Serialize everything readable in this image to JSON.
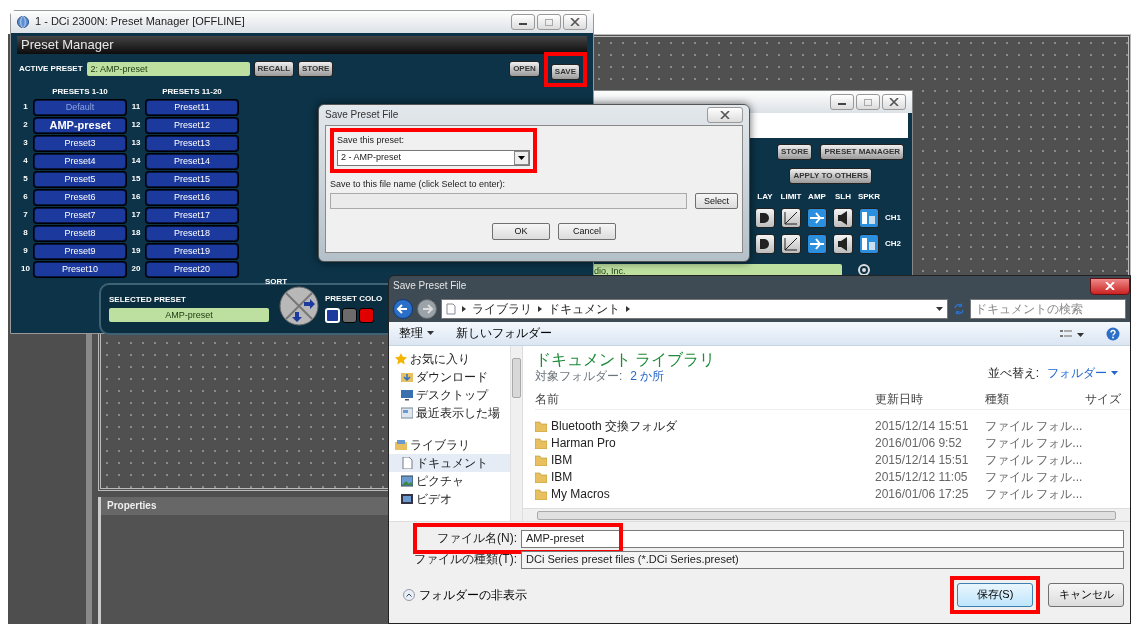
{
  "app": {
    "properties_title": "Properties"
  },
  "preset_manager": {
    "title": "1 - DCi 2300N: Preset Manager [OFFLINE]",
    "heading": "Preset Manager",
    "active_label": "ACTIVE PRESET",
    "active_value": "2: AMP-preset",
    "actions": [
      {
        "label": "RECALL",
        "highlighted": false
      },
      {
        "label": "STORE",
        "highlighted": false
      }
    ],
    "file_actions": [
      {
        "label": "OPEN",
        "highlighted": false
      },
      {
        "label": "SAVE",
        "highlighted": true
      }
    ],
    "columns": [
      {
        "heading": "PRESETS 1-10",
        "presets": [
          {
            "number": "1",
            "name": "Default",
            "selected": false,
            "dimmed": true
          },
          {
            "number": "2",
            "name": "AMP-preset",
            "selected": true,
            "dimmed": false
          },
          {
            "number": "3",
            "name": "Preset3",
            "selected": false,
            "dimmed": false
          },
          {
            "number": "4",
            "name": "Preset4",
            "selected": false,
            "dimmed": false
          },
          {
            "number": "5",
            "name": "Preset5",
            "selected": false,
            "dimmed": false
          },
          {
            "number": "6",
            "name": "Preset6",
            "selected": false,
            "dimmed": false
          },
          {
            "number": "7",
            "name": "Preset7",
            "selected": false,
            "dimmed": false
          },
          {
            "number": "8",
            "name": "Preset8",
            "selected": false,
            "dimmed": false
          },
          {
            "number": "9",
            "name": "Preset9",
            "selected": false,
            "dimmed": false
          },
          {
            "number": "10",
            "name": "Preset10",
            "selected": false,
            "dimmed": false
          }
        ]
      },
      {
        "heading": "PRESETS 11-20",
        "presets": [
          {
            "number": "11",
            "name": "Preset11",
            "selected": false,
            "dimmed": false
          },
          {
            "number": "12",
            "name": "Preset12",
            "selected": false,
            "dimmed": false
          },
          {
            "number": "13",
            "name": "Preset13",
            "selected": false,
            "dimmed": false
          },
          {
            "number": "14",
            "name": "Preset14",
            "selected": false,
            "dimmed": false
          },
          {
            "number": "15",
            "name": "Preset15",
            "selected": false,
            "dimmed": false
          },
          {
            "number": "16",
            "name": "Preset16",
            "selected": false,
            "dimmed": false
          },
          {
            "number": "17",
            "name": "Preset17",
            "selected": false,
            "dimmed": false
          },
          {
            "number": "18",
            "name": "Preset18",
            "selected": false,
            "dimmed": false
          },
          {
            "number": "19",
            "name": "Preset19",
            "selected": false,
            "dimmed": false
          },
          {
            "number": "20",
            "name": "Preset20",
            "selected": false,
            "dimmed": false
          }
        ]
      }
    ],
    "selected_label": "SELECTED PRESET",
    "selected_value": "AMP-preset",
    "sort_label": "SORT",
    "color_label": "PRESET COLO",
    "colors": [
      {
        "color": "#1d3b9e",
        "selected": true
      },
      {
        "color": "#6b6b6b",
        "selected": false
      },
      {
        "color": "#e00000",
        "selected": false
      }
    ]
  },
  "device_window": {
    "actions": [
      "STORE",
      "PRESET MANAGER",
      "APPLY TO OTHERS"
    ],
    "block_labels": [
      "LAY",
      "LIMIT",
      "AMP",
      "SLH",
      "SPKR"
    ],
    "channels": [
      {
        "label": "CH1",
        "blocks": [
          {
            "kind": "delay",
            "on": false
          },
          {
            "kind": "limiter",
            "on": false
          },
          {
            "kind": "amp",
            "on": true
          },
          {
            "kind": "speaker",
            "on": false
          },
          {
            "kind": "eq",
            "on": true
          }
        ]
      },
      {
        "label": "CH2",
        "blocks": [
          {
            "kind": "delay",
            "on": false
          },
          {
            "kind": "limiter",
            "on": false
          },
          {
            "kind": "amp",
            "on": true
          },
          {
            "kind": "speaker",
            "on": false
          },
          {
            "kind": "eq",
            "on": true
          }
        ]
      }
    ],
    "info": "dio, Inc."
  },
  "preset_dialog": {
    "title": "Save Preset File",
    "preset_label": "Save this preset:",
    "preset_value": "2 - AMP-preset",
    "highlighted": true,
    "file_label": "Save to this file name (click Select to enter):",
    "select_button": "Select",
    "buttons": [
      "OK",
      "Cancel"
    ]
  },
  "file_dialog": {
    "title": "Save Preset File",
    "breadcrumb": [
      "ライブラリ",
      "ドキュメント"
    ],
    "search_placeholder": "ドキュメントの検索",
    "toolbar": [
      {
        "label": "整理",
        "dropdown": true
      },
      {
        "label": "新しいフォルダー",
        "dropdown": false
      }
    ],
    "nav": [
      {
        "label": "お気に入り",
        "kind": "favorites",
        "selected": false,
        "children": [
          {
            "label": "ダウンロード",
            "kind": "download",
            "selected": false
          },
          {
            "label": "デスクトップ",
            "kind": "desktop",
            "selected": false
          },
          {
            "label": "最近表示した場",
            "kind": "recent",
            "selected": false
          }
        ]
      },
      {
        "label": "ライブラリ",
        "kind": "library",
        "selected": false,
        "children": [
          {
            "label": "ドキュメント",
            "kind": "document",
            "selected": true
          },
          {
            "label": "ピクチャ",
            "kind": "picture",
            "selected": false
          },
          {
            "label": "ビデオ",
            "kind": "video",
            "selected": false
          }
        ]
      }
    ],
    "library_title": "ドキュメント ライブラリ",
    "target_label": "対象フォルダー:",
    "target_link": "2 か所",
    "sort_label": "並べ替え:",
    "sort_value": "フォルダー",
    "columns": [
      "名前",
      "更新日時",
      "種類",
      "サイズ"
    ],
    "rows": [
      {
        "name": "Bluetooth 交換フォルダ",
        "modified": "2015/12/14 15:51",
        "type": "ファイル フォル..."
      },
      {
        "name": "Harman Pro",
        "modified": "2016/01/06 9:52",
        "type": "ファイル フォル..."
      },
      {
        "name": "IBM",
        "modified": "2015/12/14 15:51",
        "type": "ファイル フォル..."
      },
      {
        "name": "IBM",
        "modified": "2015/12/12 11:05",
        "type": "ファイル フォル..."
      },
      {
        "name": "My Macros",
        "modified": "2016/01/06 17:25",
        "type": "ファイル フォル..."
      }
    ],
    "filename_label": "ファイル名(N):",
    "filename_value": "AMP-preset",
    "filename_highlighted": true,
    "filetype_label": "ファイルの種類(T):",
    "filetype_value": "DCi Series preset files  (*.DCi Series.preset)",
    "hide_folders": "フォルダーの非表示",
    "buttons": [
      {
        "label": "保存(S)",
        "highlighted": true,
        "default": true
      },
      {
        "label": "キャンセル",
        "highlighted": false,
        "default": false
      }
    ]
  }
}
